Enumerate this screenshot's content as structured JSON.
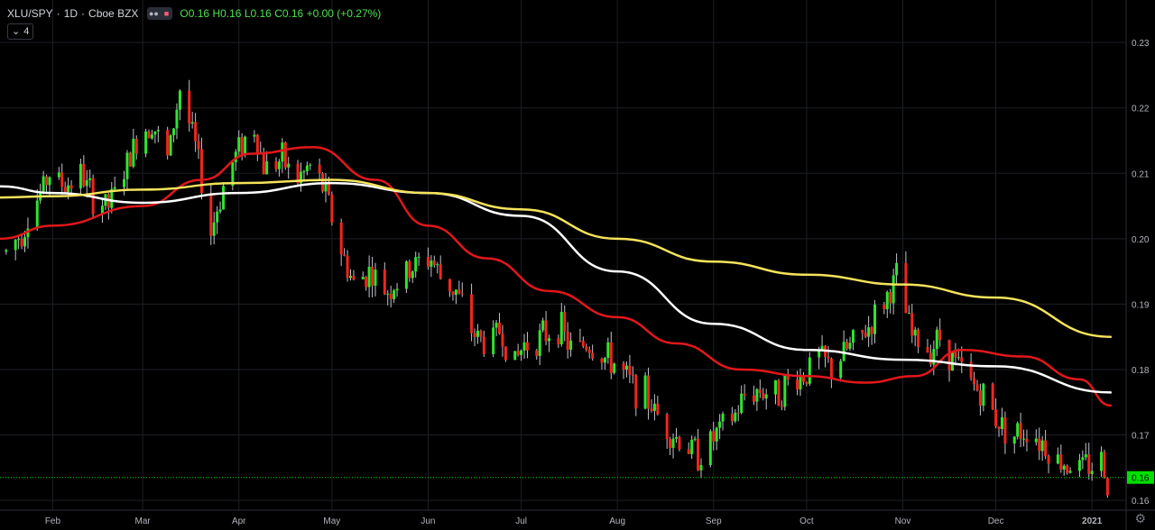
{
  "legend": {
    "symbol": "XLU/SPY",
    "interval": "1D",
    "exchange": "Cboe BZX",
    "open": "O0.16",
    "high": "H0.16",
    "low": "L0.16",
    "close": "C0.16",
    "change": "+0.00 (+0.27%)",
    "indicator_count": "4",
    "collapse_icon": "chevron-down-icon"
  },
  "price_label": "0.16",
  "settings_icon": "gear-icon",
  "colors": {
    "background": "#000000",
    "up": "#2ee52e",
    "down": "#f0261e",
    "ma_red": "#e2171b",
    "ma_white": "#ffffff",
    "ma_yellow": "#f5e35a",
    "last_price": "#00e000"
  },
  "chart_data": {
    "type": "candlestick",
    "title": "XLU/SPY · 1D · Cboe BZX",
    "x_tick_labels": [
      "Feb",
      "Mar",
      "Apr",
      "May",
      "Jun",
      "Jul",
      "Aug",
      "Sep",
      "Oct",
      "Nov",
      "Dec",
      "2021"
    ],
    "y_tick_labels": [
      "0.23",
      "0.22",
      "0.21",
      "0.20",
      "0.19",
      "0.18",
      "0.17",
      "0.16"
    ],
    "ylim": [
      0.1585,
      0.2365
    ],
    "last_price": 0.1635,
    "grid": true,
    "series": [
      {
        "name": "",
        "kind": "ohlc_closes",
        "x": [
          "2020-01-17",
          "2020-01-22",
          "2020-01-27",
          "2020-01-31",
          "2020-02-05",
          "2020-02-10",
          "2020-02-14",
          "2020-02-19",
          "2020-02-24",
          "2020-02-28",
          "2020-03-04",
          "2020-03-09",
          "2020-03-13",
          "2020-03-18",
          "2020-03-23",
          "2020-03-27",
          "2020-04-01",
          "2020-04-06",
          "2020-04-09",
          "2020-04-15",
          "2020-04-20",
          "2020-04-24",
          "2020-04-29",
          "2020-05-04",
          "2020-05-08",
          "2020-05-13",
          "2020-05-18",
          "2020-05-22",
          "2020-05-28",
          "2020-06-02",
          "2020-06-05",
          "2020-06-10",
          "2020-06-15",
          "2020-06-19",
          "2020-06-24",
          "2020-06-29",
          "2020-07-02",
          "2020-07-08",
          "2020-07-13",
          "2020-07-17",
          "2020-07-22",
          "2020-07-27",
          "2020-07-31",
          "2020-08-05",
          "2020-08-10",
          "2020-08-14",
          "2020-08-19",
          "2020-08-24",
          "2020-08-28",
          "2020-09-02",
          "2020-09-08",
          "2020-09-11",
          "2020-09-16",
          "2020-09-21",
          "2020-09-25",
          "2020-09-30",
          "2020-10-05",
          "2020-10-09",
          "2020-10-14",
          "2020-10-19",
          "2020-10-23",
          "2020-10-28",
          "2020-10-30",
          "2020-11-04",
          "2020-11-09",
          "2020-11-13",
          "2020-11-18",
          "2020-11-23",
          "2020-11-27",
          "2020-12-02",
          "2020-12-07",
          "2020-12-11",
          "2020-12-16",
          "2020-12-21",
          "2020-12-28",
          "2021-01-04",
          "2021-01-06"
        ],
        "close": [
          0.198,
          0.201,
          0.206,
          0.21,
          0.208,
          0.21,
          0.206,
          0.205,
          0.21,
          0.215,
          0.218,
          0.212,
          0.223,
          0.214,
          0.201,
          0.208,
          0.214,
          0.217,
          0.211,
          0.212,
          0.209,
          0.211,
          0.207,
          0.198,
          0.193,
          0.195,
          0.192,
          0.193,
          0.196,
          0.197,
          0.194,
          0.192,
          0.186,
          0.184,
          0.186,
          0.181,
          0.184,
          0.185,
          0.187,
          0.183,
          0.184,
          0.182,
          0.181,
          0.178,
          0.176,
          0.173,
          0.17,
          0.168,
          0.167,
          0.17,
          0.173,
          0.176,
          0.177,
          0.176,
          0.178,
          0.179,
          0.182,
          0.18,
          0.183,
          0.185,
          0.188,
          0.192,
          0.194,
          0.185,
          0.183,
          0.185,
          0.181,
          0.178,
          0.176,
          0.172,
          0.17,
          0.171,
          0.169,
          0.166,
          0.165,
          0.166,
          0.163
        ]
      },
      {
        "name": "",
        "kind": "moving_average",
        "color": "#e2171b",
        "x": [
          "2020-01-15",
          "2020-02-01",
          "2020-03-01",
          "2020-03-20",
          "2020-04-05",
          "2020-04-25",
          "2020-05-15",
          "2020-06-01",
          "2020-06-20",
          "2020-07-10",
          "2020-08-01",
          "2020-08-20",
          "2020-09-10",
          "2020-10-01",
          "2020-10-20",
          "2020-11-05",
          "2020-11-20",
          "2020-12-10",
          "2020-12-28",
          "2021-01-07"
        ],
        "y": [
          0.2,
          0.202,
          0.205,
          0.209,
          0.213,
          0.214,
          0.209,
          0.202,
          0.197,
          0.192,
          0.188,
          0.184,
          0.18,
          0.179,
          0.178,
          0.179,
          0.183,
          0.182,
          0.1785,
          0.1745
        ]
      },
      {
        "name": "",
        "kind": "moving_average",
        "color": "#ffffff",
        "x": [
          "2020-01-15",
          "2020-02-01",
          "2020-03-01",
          "2020-04-01",
          "2020-05-01",
          "2020-06-01",
          "2020-07-01",
          "2020-08-01",
          "2020-09-01",
          "2020-10-01",
          "2020-11-01",
          "2020-12-01",
          "2021-01-07"
        ],
        "y": [
          0.208,
          0.207,
          0.2055,
          0.207,
          0.2085,
          0.207,
          0.2035,
          0.195,
          0.187,
          0.183,
          0.1815,
          0.1805,
          0.1765
        ]
      },
      {
        "name": "",
        "kind": "moving_average",
        "color": "#f5e35a",
        "x": [
          "2020-01-15",
          "2020-02-01",
          "2020-03-01",
          "2020-04-01",
          "2020-05-01",
          "2020-06-01",
          "2020-07-01",
          "2020-08-01",
          "2020-09-01",
          "2020-10-01",
          "2020-11-01",
          "2020-12-01",
          "2021-01-07"
        ],
        "y": [
          0.2063,
          0.2065,
          0.2075,
          0.2085,
          0.209,
          0.207,
          0.2045,
          0.2,
          0.1965,
          0.1945,
          0.193,
          0.191,
          0.185
        ]
      }
    ]
  }
}
